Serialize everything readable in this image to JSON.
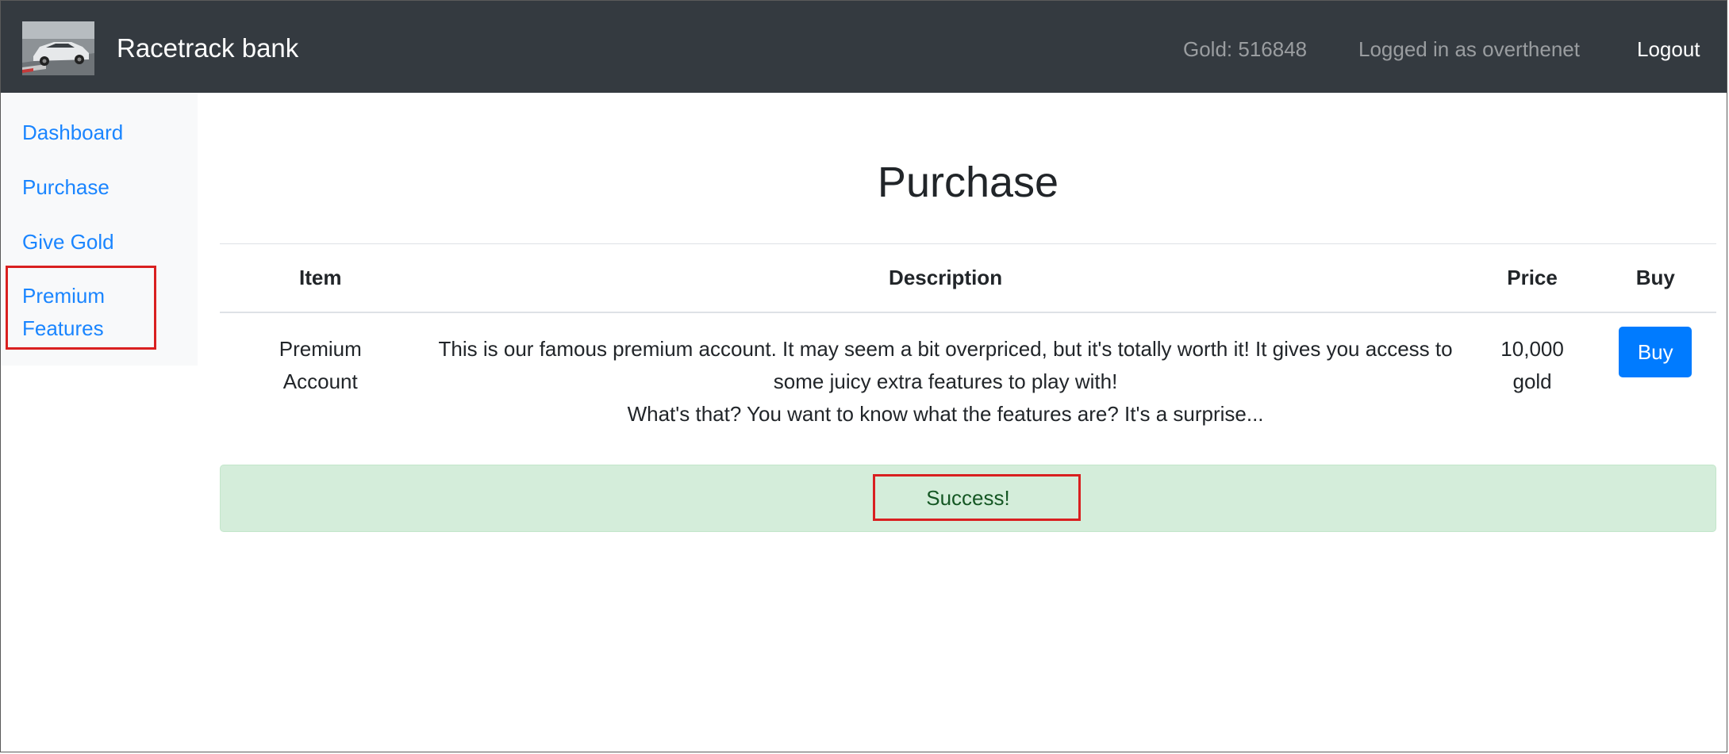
{
  "navbar": {
    "brand_name": "Racetrack bank",
    "logo_icon": "race-car-logo-icon",
    "gold_text": "Gold: 516848",
    "user_text": "Logged in as overthenet",
    "logout_label": "Logout"
  },
  "sidebar": {
    "items": [
      {
        "label": "Dashboard"
      },
      {
        "label": "Purchase"
      },
      {
        "label": "Give Gold"
      },
      {
        "label": "Premium Features"
      }
    ]
  },
  "main": {
    "title": "Purchase",
    "table": {
      "headers": [
        "Item",
        "Description",
        "Price",
        "Buy"
      ],
      "rows": [
        {
          "item": "Premium Account",
          "description_line1": "This is our famous premium account. It may seem a bit overpriced, but it's totally worth it! It gives you access to some juicy extra features to play with!",
          "description_line2": "What's that? You want to know what the features are? It's a surprise...",
          "price": "10,000 gold",
          "buy_label": "Buy"
        }
      ]
    },
    "alert": {
      "message": "Success!"
    }
  },
  "colors": {
    "navbar_bg": "#343a40",
    "link": "#1a85ff",
    "primary_button": "#007bff",
    "success_bg": "#d4edda",
    "success_text": "#155724",
    "highlight": "#d92020"
  }
}
